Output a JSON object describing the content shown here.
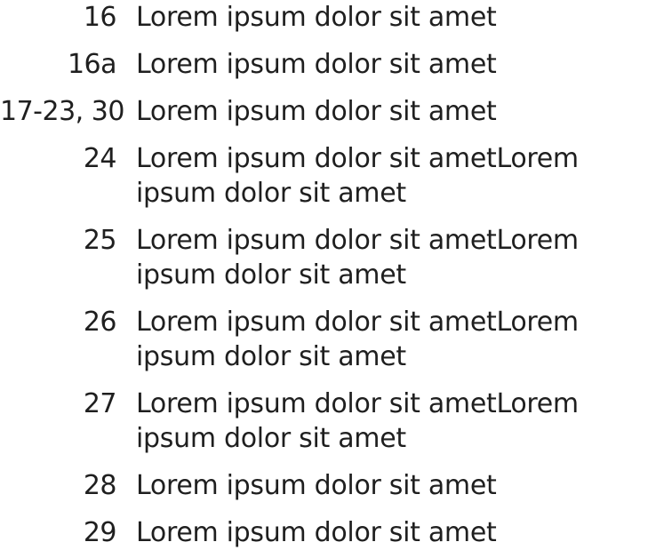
{
  "items": [
    {
      "number": "16",
      "text": "Lorem ipsum dolor sit amet"
    },
    {
      "number": "16a",
      "text": "Lorem ipsum dolor sit amet"
    },
    {
      "number": "17-23, 30",
      "text": "Lorem ipsum dolor sit amet"
    },
    {
      "number": "24",
      "text": "Lorem ipsum dolor sit ametLorem ipsum dolor sit amet"
    },
    {
      "number": "25",
      "text": "Lorem ipsum dolor sit ametLorem ipsum dolor sit amet"
    },
    {
      "number": "26",
      "text": "Lorem ipsum dolor sit ametLorem ipsum dolor sit amet"
    },
    {
      "number": "27",
      "text": "Lorem ipsum dolor sit ametLorem ipsum dolor sit amet"
    },
    {
      "number": "28",
      "text": "Lorem ipsum dolor sit amet"
    },
    {
      "number": "29",
      "text": "Lorem ipsum dolor sit amet"
    }
  ]
}
